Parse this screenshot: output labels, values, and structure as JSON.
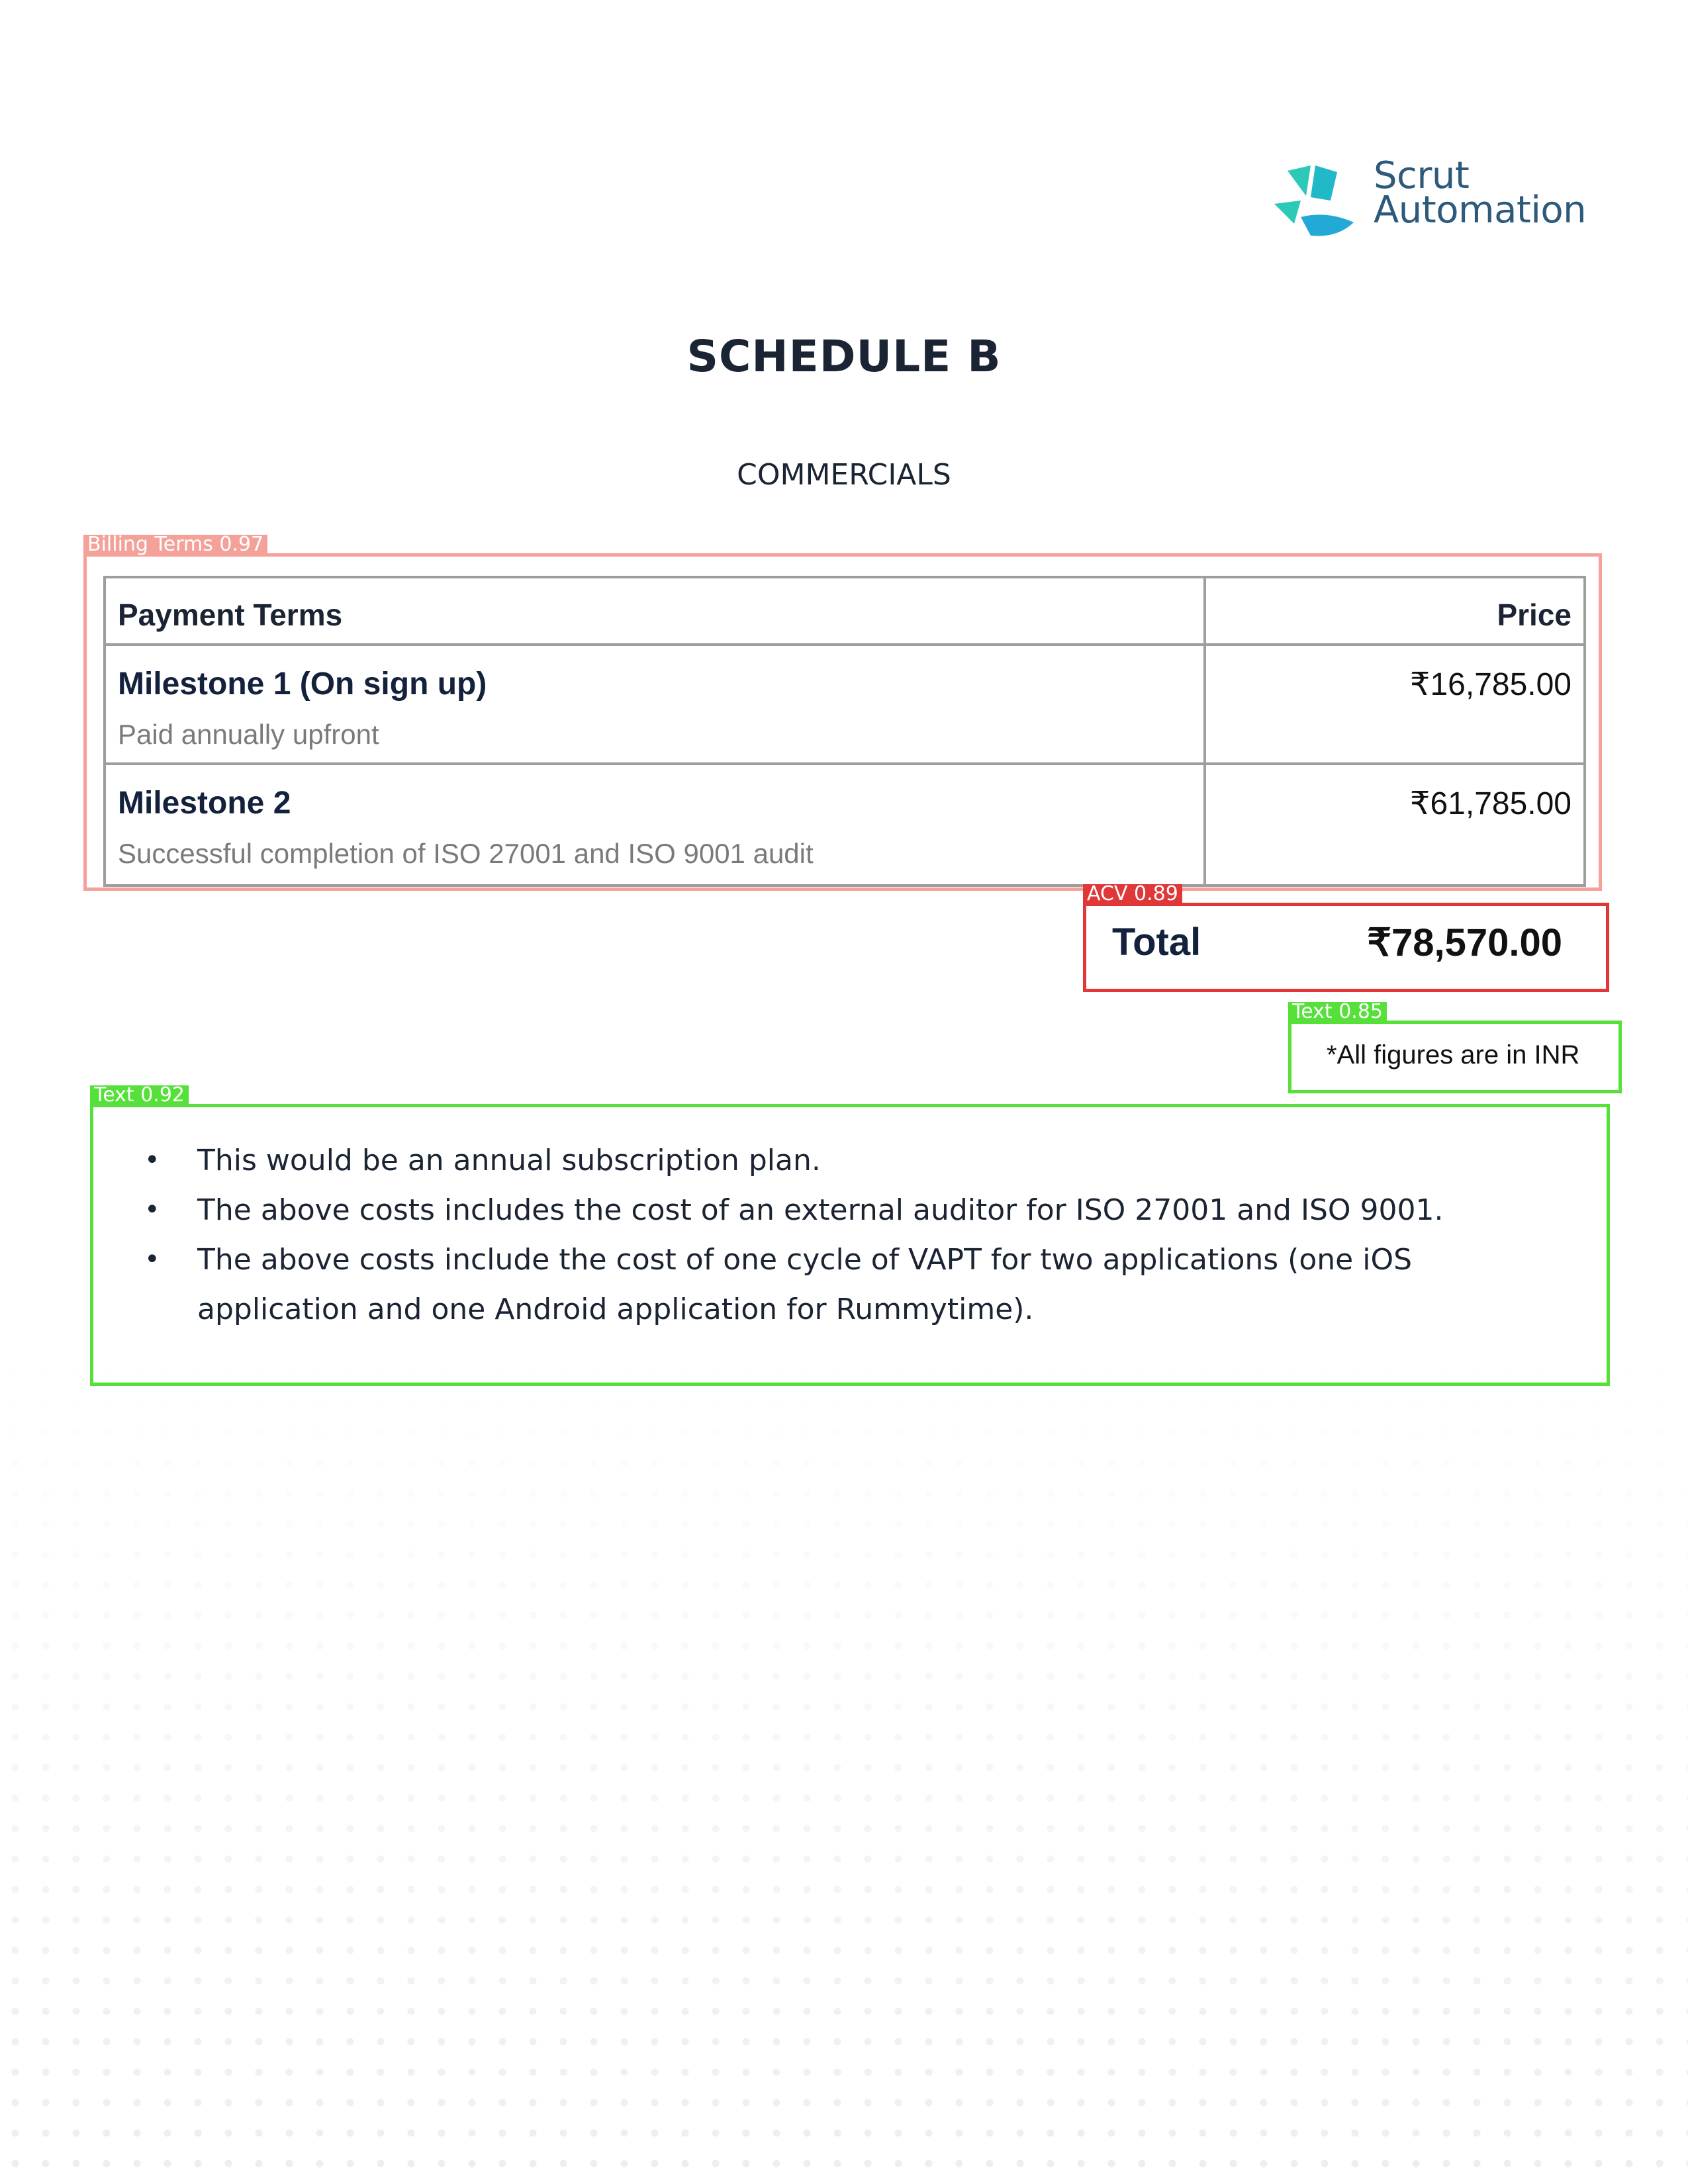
{
  "logo": {
    "line1": "Scrut",
    "line2": "Automation",
    "colors": {
      "mark": "#2cc9b9",
      "text": "#2d5a7b"
    }
  },
  "heading": {
    "title": "SCHEDULE B",
    "subtitle": "COMMERCIALS"
  },
  "detections": {
    "billing": "Billing Terms 0.97",
    "acv": "ACV 0.89",
    "inr": "Text 0.85",
    "notes": "Text 0.92"
  },
  "table": {
    "headers": {
      "left": "Payment Terms",
      "right": "Price"
    },
    "rows": [
      {
        "title": "Milestone 1 (On sign up)",
        "description": "Paid annually upfront",
        "price": "₹16,785.00"
      },
      {
        "title": "Milestone 2",
        "description": "Successful completion of ISO 27001 and ISO 9001 audit",
        "price": "₹61,785.00"
      }
    ]
  },
  "total": {
    "label": "Total",
    "value": "₹78,570.00"
  },
  "currency_note": "*All figures are in INR",
  "notes": [
    "This would be an annual subscription plan.",
    "The above costs includes the cost of an external auditor for ISO 27001 and ISO 9001.",
    "The above costs include the cost of one cycle of VAPT for two applications (one iOS application and one Android application for Rummytime)."
  ],
  "colors": {
    "billing_box": "#f4a19a",
    "acv_box": "#e03838",
    "text_box": "#55e03a"
  }
}
